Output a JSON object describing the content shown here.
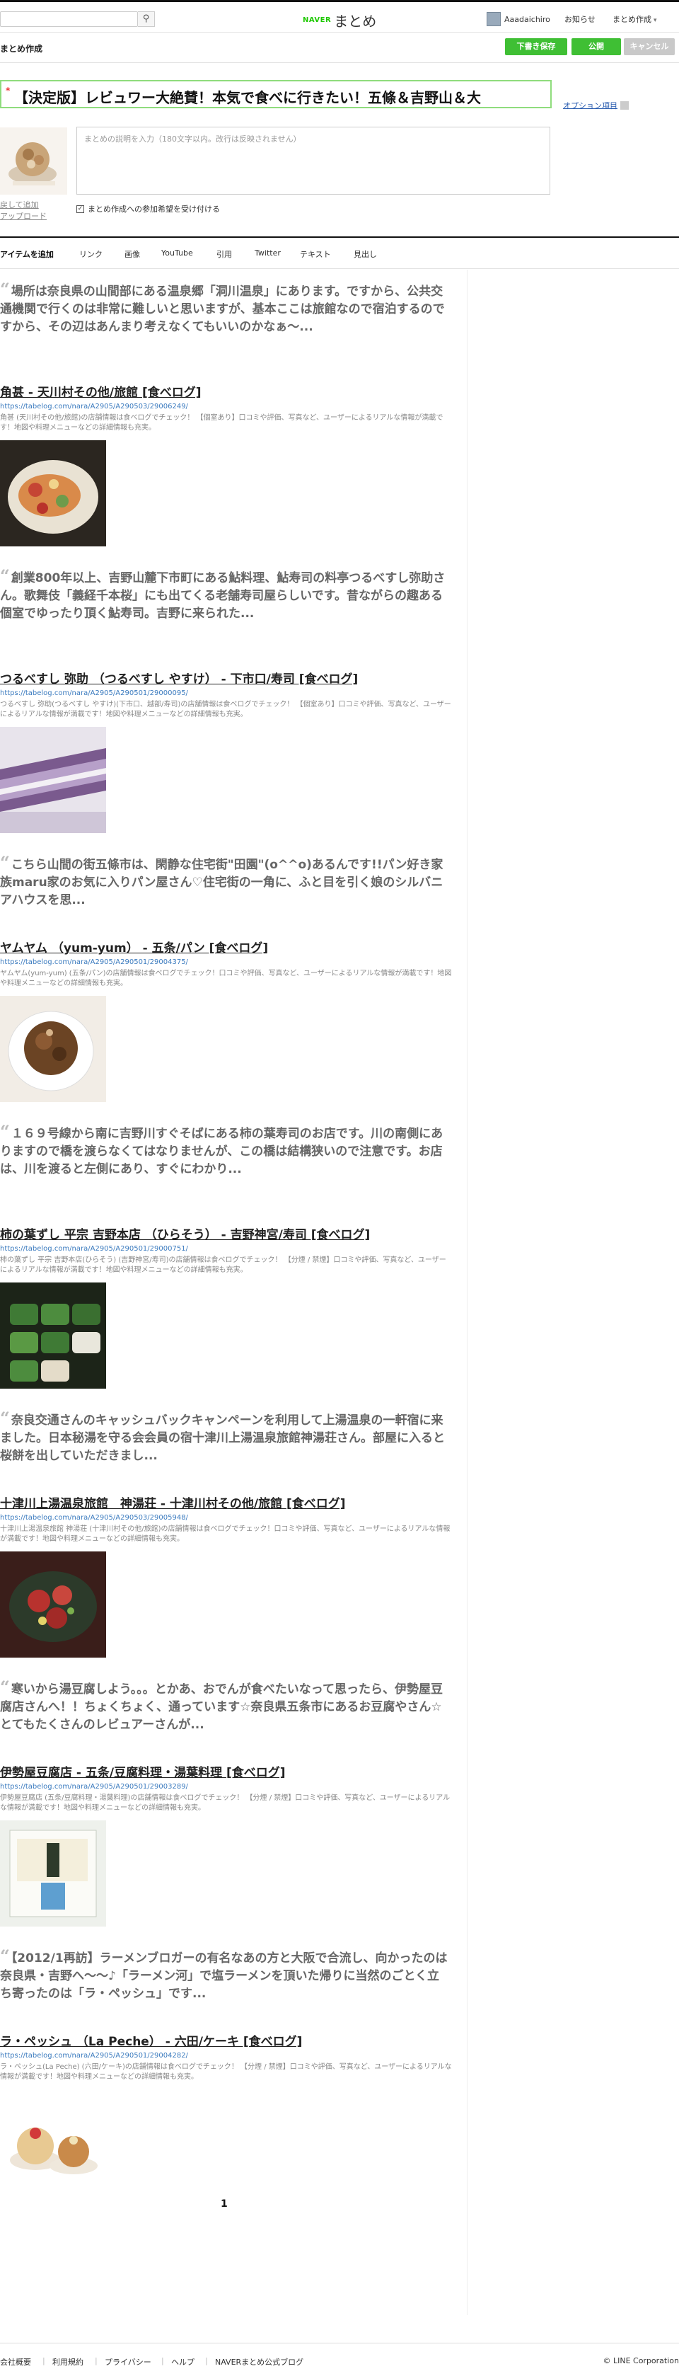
{
  "header": {
    "search_placeholder": "",
    "logo_brand": "NAVER",
    "logo_name": "まとめ",
    "username": "Aaadaichiro",
    "notice": "お知らせ",
    "matome_menu": "まとめ作成"
  },
  "editbar": {
    "heading": "まとめ作成",
    "draft_label": "下書き保存",
    "publish_label": "公開",
    "cancel_label": "キャンセル"
  },
  "editor": {
    "title": "【決定版】レビュワー大絶賛！本気で食べに行きたい！五條＆吉野山＆大",
    "option_label": "オプション項目",
    "desc_placeholder": "まとめの説明を入力（180文字以内。改行は反映されません）",
    "thumb_remove": "戻して追加",
    "thumb_upload": "アップロード",
    "participate_label": "まとめ作成への参加希望を受け付ける"
  },
  "toolbar": {
    "label": "アイテムを追加",
    "items": [
      "リンク",
      "画像",
      "YouTube",
      "引用",
      "Twitter",
      "テキスト",
      "見出し"
    ]
  },
  "items": [
    {
      "quote": "場所は奈良県の山間部にある温泉郷「洞川温泉」にあります。ですから、公共交通機関で行くのは非常に難しいと思いますが、基本ここは旅館なので宿泊するのですから、その辺はあんまり考えなくてもいいのかなぁ〜...",
      "title": "角甚 - 天川村その他/旅館 [食べログ]",
      "url": "https://tabelog.com/nara/A2905/A290503/29006249/",
      "desc": "角甚 (天川村その他/旅館)の店舗情報は食べログでチェック！ 【個室あり】口コミや評価、写真など、ユーザーによるリアルな情報が満載です！地図や料理メニューなどの詳細情報も充実。"
    },
    {
      "quote": "創業800年以上、吉野山麓下市町にある鮎料理、鮎寿司の料亭つるべすし弥助さん。歌舞伎「義経千本桜」にも出てくる老舗寿司屋らしいです。昔ながらの趣ある個室でゆったり頂く鮎寿司。吉野に来られた...",
      "title": "つるべすし 弥助 （つるべすし やすけ） - 下市口/寿司 [食べログ]",
      "url": "https://tabelog.com/nara/A2905/A290501/29000095/",
      "desc": "つるべすし 弥助(つるべすし やすけ)(下市口、越部/寿司)の店舗情報は食べログでチェック！ 【個室あり】口コミや評価、写真など、ユーザーによるリアルな情報が満載です！地図や料理メニューなどの詳細情報も充実。"
    },
    {
      "quote": "こちら山間の街五條市は、閑静な住宅街\"田園\"(o^^o)あるんです!!パン好き家族maru家のお気に入りパン屋さん♡住宅街の一角に、ふと目を引く娘のシルバニアハウスを思...",
      "title": "ヤムヤム （yum-yum） - 五条/パン [食べログ]",
      "url": "https://tabelog.com/nara/A2905/A290501/29004375/",
      "desc": "ヤムヤム(yum-yum) (五条/パン)の店舗情報は食べログでチェック！口コミや評価、写真など、ユーザーによるリアルな情報が満載です！地図や料理メニューなどの詳細情報も充実。"
    },
    {
      "quote": "１６９号線から南に吉野川すぐそばにある柿の葉寿司のお店です。川の南側にありますので橋を渡らなくてはなりませんが、この橋は結構狭いので注意です。お店は、川を渡ると左側にあり、すぐにわかり...",
      "title": "柿の葉ずし 平宗 吉野本店 （ひらそう） - 吉野神宮/寿司 [食べログ]",
      "url": "https://tabelog.com/nara/A2905/A290501/29000751/",
      "desc": "柿の葉ずし 平宗 吉野本店(ひらそう) (吉野神宮/寿司)の店舗情報は食べログでチェック！ 【分煙 / 禁煙】口コミや評価、写真など、ユーザーによるリアルな情報が満載です！地図や料理メニューなどの詳細情報も充実。"
    },
    {
      "quote": "奈良交通さんのキャッシュバックキャンペーンを利用して上湯温泉の一軒宿に来ました。日本秘湯を守る会会員の宿十津川上湯温泉旅館神湯荘さん。部屋に入ると桜餅を出していただきまし...",
      "title": "十津川上湯温泉旅館　神湯荘 - 十津川村その他/旅館 [食べログ]",
      "url": "https://tabelog.com/nara/A2905/A290503/29005948/",
      "desc": "十津川上湯温泉旅館 神湯荘 (十津川村その他/旅館)の店舗情報は食べログでチェック！口コミや評価、写真など、ユーザーによるリアルな情報が満載です！地図や料理メニューなどの詳細情報も充実。"
    },
    {
      "quote": "寒いから湯豆腐しよう。。。とかあ、おでんが食べたいなって思ったら、伊勢屋豆腐店さんへ！！ちょくちょく、通っています☆奈良県五条市にあるお豆腐やさん☆とてもたくさんのレビュアーさんが...",
      "title": "伊勢屋豆腐店 - 五条/豆腐料理・湯葉料理 [食べログ]",
      "url": "https://tabelog.com/nara/A2905/A290501/29003289/",
      "desc": "伊勢屋豆腐店 (五条/豆腐料理・湯葉料理)の店舗情報は食べログでチェック！ 【分煙 / 禁煙】口コミや評価、写真など、ユーザーによるリアルな情報が満載です！地図や料理メニューなどの詳細情報も充実。"
    },
    {
      "quote": "【2012/1再訪】ラーメンブロガーの有名なあの方と大阪で合流し、向かったのは奈良県・吉野へ〜〜♪「ラーメン河」で塩ラーメンを頂いた帰りに当然のごとく立ち寄ったのは「ラ・ペッシュ」です...",
      "title": "ラ・ペッシュ （La Peche） - 六田/ケーキ [食べログ]",
      "url": "https://tabelog.com/nara/A2905/A290501/29004282/",
      "desc": "ラ・ペッシュ(La Peche) (六田/ケーキ)の店舗情報は食べログでチェック！ 【分煙 / 禁煙】口コミや評価、写真など、ユーザーによるリアルな情報が満載です！地図や料理メニューなどの詳細情報も充実。"
    }
  ],
  "pagination": {
    "current": "1"
  },
  "footer": {
    "links": [
      "会社概要",
      "利用規約",
      "プライバシー",
      "ヘルプ",
      "NAVERまとめ公式ブログ"
    ],
    "copyright": "© LINE Corporation"
  }
}
